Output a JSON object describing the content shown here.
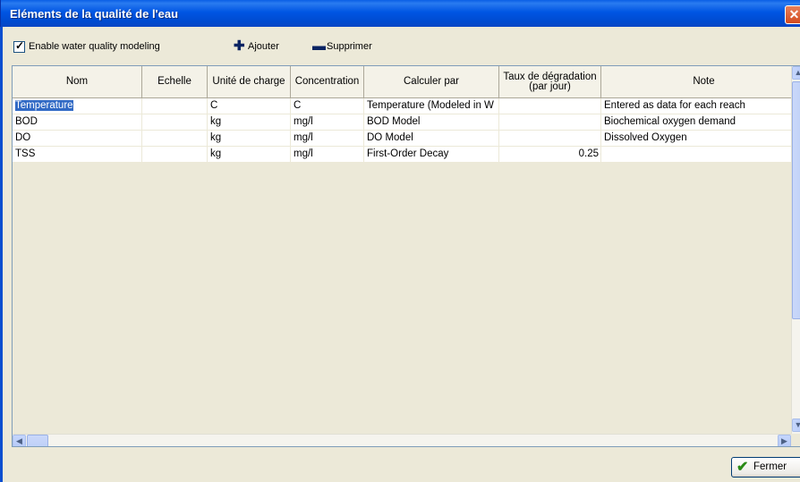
{
  "window": {
    "title": "Eléments de la qualité de l'eau",
    "close_glyph": "✕"
  },
  "toolbar": {
    "enable_checked": true,
    "enable_label": "Enable water quality modeling",
    "add_label": "Ajouter",
    "remove_label": "Supprimer",
    "add_icon": "plus-icon",
    "remove_icon": "minus-icon"
  },
  "table": {
    "columns": [
      "Nom",
      "Echelle",
      "Unité de charge",
      "Concentration",
      "Calculer par",
      "Taux de dégradation (par jour)",
      "Note"
    ],
    "rows": [
      [
        "Temperature",
        "",
        "C",
        "C",
        "Temperature (Modeled in W",
        "",
        "Entered as data for each reach"
      ],
      [
        "BOD",
        "",
        "kg",
        "mg/l",
        "BOD Model",
        "",
        "Biochemical oxygen demand"
      ],
      [
        "DO",
        "",
        "kg",
        "mg/l",
        "DO Model",
        "",
        "Dissolved Oxygen"
      ],
      [
        "TSS",
        "",
        "kg",
        "mg/l",
        "First-Order Decay",
        "0.25",
        ""
      ]
    ],
    "selected_row": 0
  },
  "footer": {
    "close_label": "Fermer",
    "close_icon": "checkmark-icon"
  },
  "colors": {
    "title_bar": "#0055E3",
    "selection": "#316AC5",
    "dialog_bg": "#ECE9D8"
  }
}
